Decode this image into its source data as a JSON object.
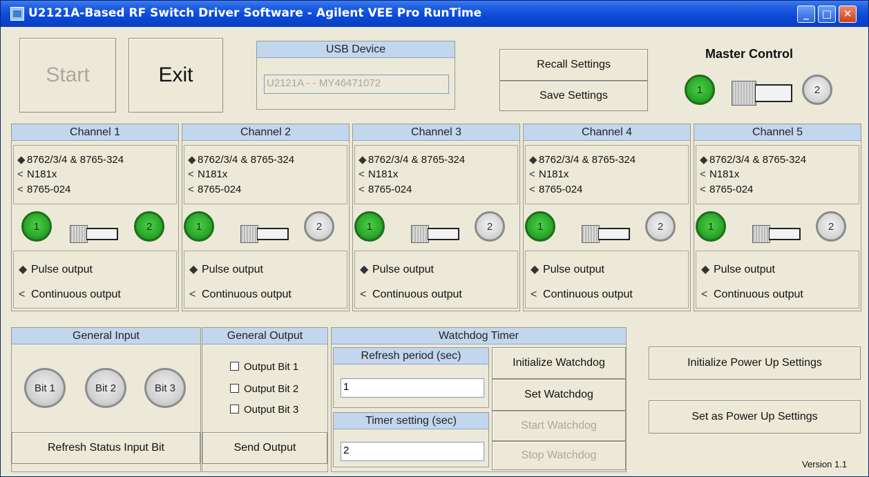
{
  "window": {
    "title": "U2121A-Based RF Switch Driver Software - Agilent VEE Pro RunTime",
    "controls": {
      "minimize": "_",
      "maximize": "□",
      "close": "✕"
    }
  },
  "toolbar": {
    "start_label": "Start",
    "exit_label": "Exit"
  },
  "usb_device": {
    "header": "USB Device",
    "value": "U2121A - - MY46471072"
  },
  "settings": {
    "recall_label": "Recall Settings",
    "save_label": "Save Settings"
  },
  "master_control": {
    "title": "Master Control",
    "led1": "1",
    "led2": "2"
  },
  "channels": [
    {
      "header": "Channel 1",
      "opt1": "8762/3/4 & 8765-324",
      "opt2": "N181x",
      "opt3": "8765-024",
      "led1": "1",
      "led2": "2",
      "pulse": "Pulse output",
      "cont": "Continuous output"
    },
    {
      "header": "Channel 2",
      "opt1": "8762/3/4 & 8765-324",
      "opt2": "N181x",
      "opt3": "8765-024",
      "led1": "1",
      "led2": "2",
      "pulse": "Pulse output",
      "cont": "Continuous output"
    },
    {
      "header": "Channel 3",
      "opt1": "8762/3/4 & 8765-324",
      "opt2": "N181x",
      "opt3": "8765-024",
      "led1": "1",
      "led2": "2",
      "pulse": "Pulse output",
      "cont": "Continuous output"
    },
    {
      "header": "Channel 4",
      "opt1": "8762/3/4 & 8765-324",
      "opt2": "N181x",
      "opt3": "8765-024",
      "led1": "1",
      "led2": "2",
      "pulse": "Pulse output",
      "cont": "Continuous output"
    },
    {
      "header": "Channel 5",
      "opt1": "8762/3/4 & 8765-324",
      "opt2": "N181x",
      "opt3": "8765-024",
      "led1": "1",
      "led2": "2",
      "pulse": "Pulse output",
      "cont": "Continuous output"
    }
  ],
  "general_input": {
    "header": "General Input",
    "bits": [
      "Bit 1",
      "Bit 2",
      "Bit 3"
    ],
    "refresh_label": "Refresh Status Input Bit"
  },
  "general_output": {
    "header": "General Output",
    "bits": [
      "Output Bit 1",
      "Output Bit 2",
      "Output Bit 3"
    ],
    "send_label": "Send Output"
  },
  "watchdog": {
    "header": "Watchdog Timer",
    "refresh_header": "Refresh period (sec)",
    "refresh_value": "1",
    "timer_header": "Timer setting (sec)",
    "timer_value": "2",
    "init_label": "Initialize Watchdog",
    "set_label": "Set Watchdog",
    "start_label": "Start Watchdog",
    "stop_label": "Stop Watchdog"
  },
  "power_up": {
    "init_label": "Initialize Power Up Settings",
    "set_label": "Set as Power Up Settings"
  },
  "version": "Version 1.1"
}
